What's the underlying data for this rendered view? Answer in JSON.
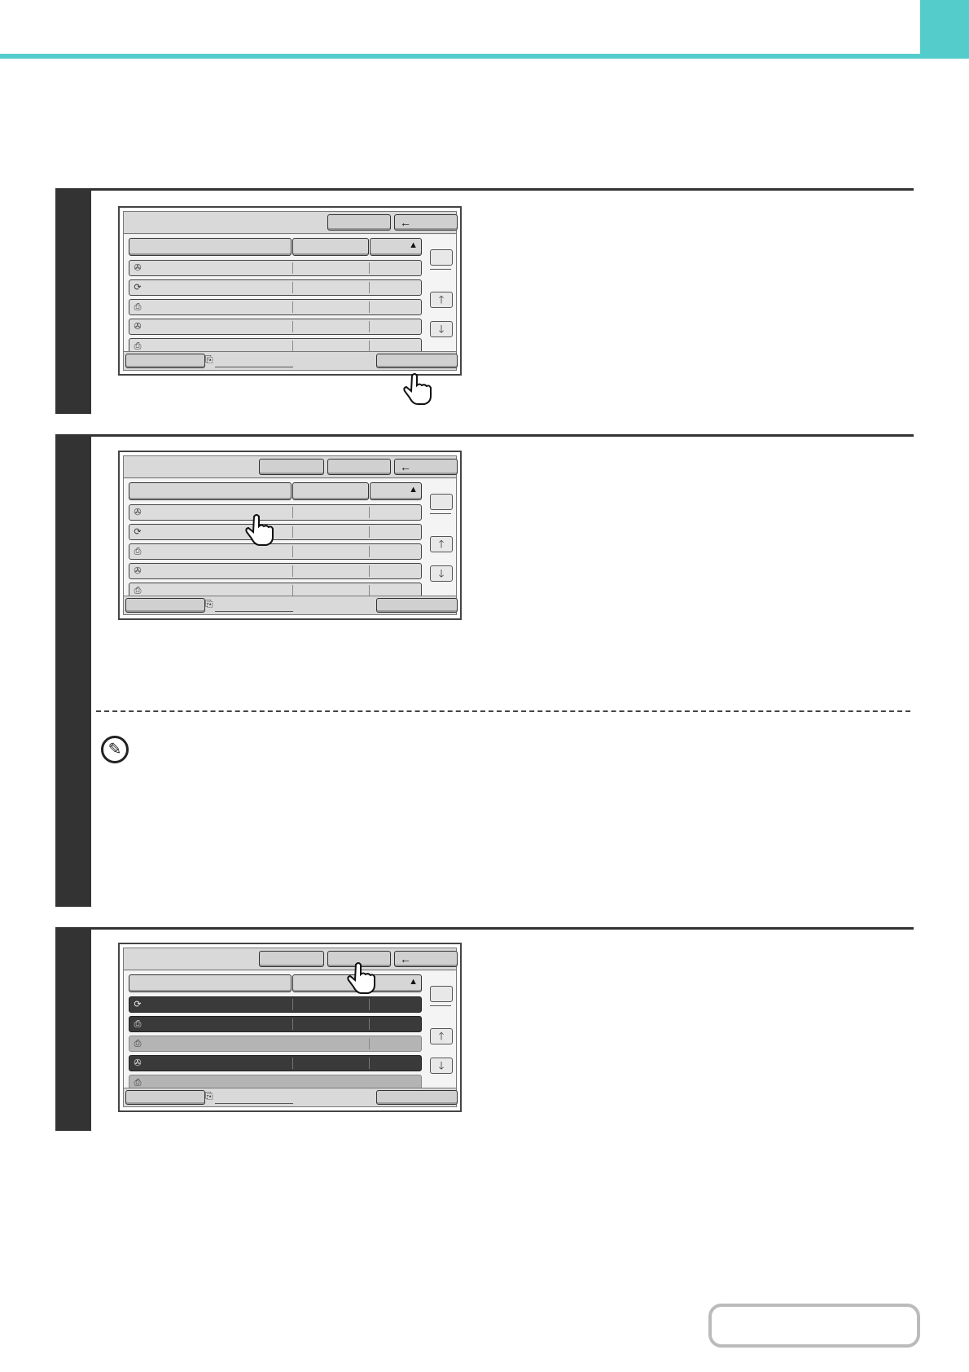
{
  "header": {
    "accent_color": "#55cccc"
  },
  "steps": [
    {
      "id": "step-1",
      "screen_state": "default",
      "selected_rows": []
    },
    {
      "id": "step-2",
      "screen_state": "row-touch",
      "selected_rows": []
    },
    {
      "id": "step-3",
      "screen_state": "rows-selected",
      "selected_rows": [
        1,
        2,
        4
      ]
    }
  ],
  "screen": {
    "back_icon": "←",
    "sort_icon": "▲",
    "up_icon": "🡑",
    "down_icon": "🡓",
    "job_icons": [
      "✇",
      "⟳",
      "⎙",
      "✇",
      "⎙"
    ]
  },
  "note": {
    "icon": "pencil-icon"
  },
  "contents_button": {
    "label": ""
  }
}
